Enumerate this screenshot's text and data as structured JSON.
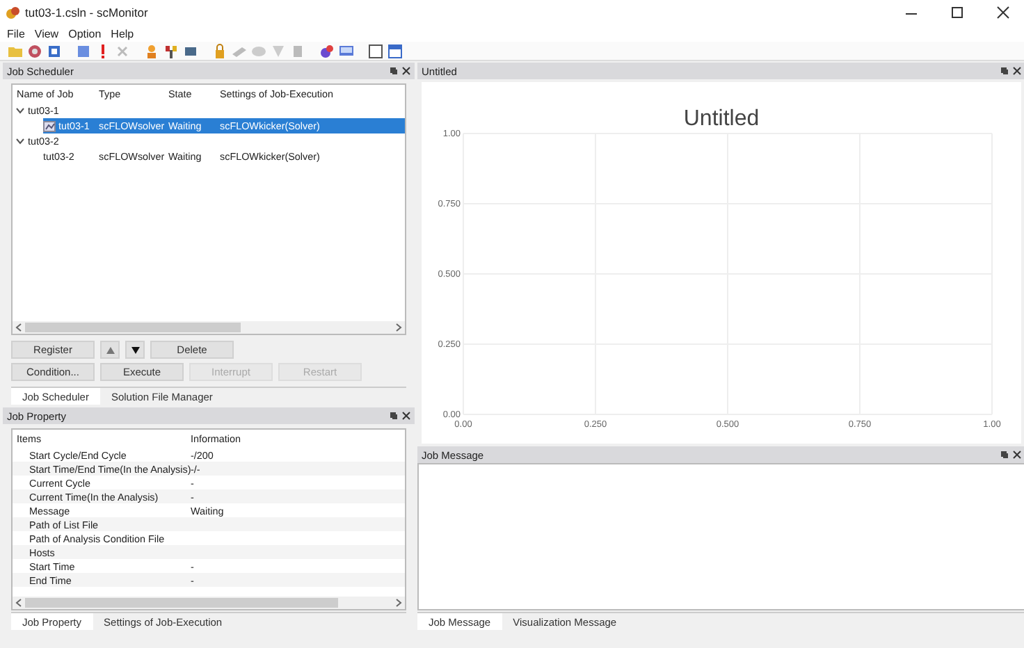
{
  "window": {
    "title": "tut03-1.csln - scMonitor"
  },
  "menu": [
    "File",
    "View",
    "Option",
    "Help"
  ],
  "job_scheduler": {
    "title": "Job Scheduler",
    "columns": [
      "Name of Job",
      "Type",
      "State",
      "Settings of Job-Execution"
    ],
    "tree": [
      {
        "name": "tut03-1",
        "expanded": true,
        "selected": false,
        "children": [
          {
            "name": "tut03-1",
            "type": "scFLOWsolver",
            "state": "Waiting",
            "settings": "scFLOWkicker(Solver)",
            "selected": true
          }
        ]
      },
      {
        "name": "tut03-2",
        "expanded": true,
        "selected": false,
        "children": [
          {
            "name": "tut03-2",
            "type": "scFLOWsolver",
            "state": "Waiting",
            "settings": "scFLOWkicker(Solver)",
            "selected": false
          }
        ]
      }
    ],
    "buttons": [
      [
        {
          "kind": "text",
          "label": "Register",
          "disabled": false
        },
        {
          "kind": "up",
          "disabled": false
        },
        {
          "kind": "down",
          "disabled": false
        },
        {
          "kind": "text",
          "label": "Delete",
          "disabled": false
        }
      ],
      [
        {
          "kind": "text",
          "label": "Condition...",
          "disabled": false
        },
        {
          "kind": "text",
          "label": "Execute",
          "disabled": false
        },
        {
          "kind": "text",
          "label": "Interrupt",
          "disabled": true
        },
        {
          "kind": "text",
          "label": "Restart",
          "disabled": true
        }
      ]
    ],
    "tabs": [
      {
        "label": "Job Scheduler",
        "selected": true
      },
      {
        "label": "Solution File Manager",
        "selected": false
      }
    ]
  },
  "job_property": {
    "title": "Job Property",
    "columns": [
      "Items",
      "Information"
    ],
    "rows": [
      {
        "item": "Start Cycle/End Cycle",
        "info": "-/200"
      },
      {
        "item": "Start Time/End Time(In the Analysis)",
        "info": "-/-"
      },
      {
        "item": "Current Cycle",
        "info": "-"
      },
      {
        "item": "Current Time(In the Analysis)",
        "info": "-"
      },
      {
        "item": "Message",
        "info": "Waiting"
      },
      {
        "item": "Path of List File"
      },
      {
        "item": "Path of Analysis Condition File"
      },
      {
        "item": "Hosts"
      },
      {
        "item": "Start Time",
        "info": "-"
      },
      {
        "item": "End Time",
        "info": "-"
      }
    ],
    "tabs": [
      {
        "label": "Job Property",
        "selected": true
      },
      {
        "label": "Settings of Job-Execution",
        "selected": false
      }
    ]
  },
  "graph_panel": {
    "title": "Untitled",
    "chart_data": {
      "type": "line",
      "title": "Untitled",
      "grid": true,
      "xlim": [
        0,
        1
      ],
      "ylim": [
        0,
        1
      ],
      "xticks": [
        {
          "value": 0,
          "label": "0.00"
        },
        {
          "value": 0.25,
          "label": "0.250"
        },
        {
          "value": 0.5,
          "label": "0.500"
        },
        {
          "value": 0.75,
          "label": "0.750"
        },
        {
          "value": 1,
          "label": "1.00"
        }
      ],
      "yticks": [
        {
          "value": 0,
          "label": "0.00"
        },
        {
          "value": 0.25,
          "label": "0.250"
        },
        {
          "value": 0.5,
          "label": "0.500"
        },
        {
          "value": 0.75,
          "label": "0.750"
        },
        {
          "value": 1,
          "label": "1.00"
        }
      ]
    }
  },
  "job_message": {
    "title": "Job Message",
    "tabs": [
      {
        "label": "Job Message",
        "selected": true
      },
      {
        "label": "Visualization Message",
        "selected": false
      }
    ]
  }
}
